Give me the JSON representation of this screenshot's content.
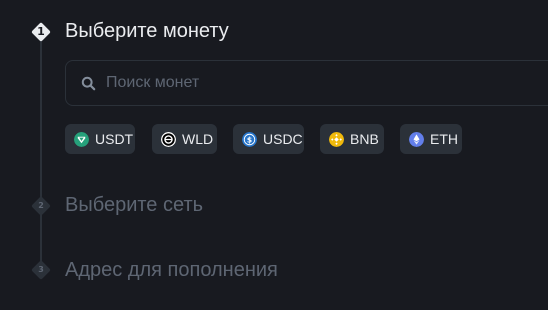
{
  "steps": [
    {
      "number": "1",
      "title": "Выберите монету",
      "active": true
    },
    {
      "number": "2",
      "title": "Выберите сеть",
      "active": false
    },
    {
      "number": "3",
      "title": "Адрес для пополнения",
      "active": false
    }
  ],
  "search": {
    "placeholder": "Поиск монет",
    "value": "",
    "icon": "search-icon"
  },
  "coins": [
    {
      "symbol": "USDT",
      "icon": "usdt-icon",
      "color": "#26a17b"
    },
    {
      "symbol": "WLD",
      "icon": "wld-icon",
      "color": "#000000"
    },
    {
      "symbol": "USDC",
      "icon": "usdc-icon",
      "color": "#2775ca"
    },
    {
      "symbol": "BNB",
      "icon": "bnb-icon",
      "color": "#f0b90b"
    },
    {
      "symbol": "ETH",
      "icon": "eth-icon",
      "color": "#627eea"
    }
  ],
  "colors": {
    "background": "#181a20",
    "active_text": "#eaecef",
    "inactive_text": "#5e6673",
    "chip_background": "#2b3139"
  }
}
